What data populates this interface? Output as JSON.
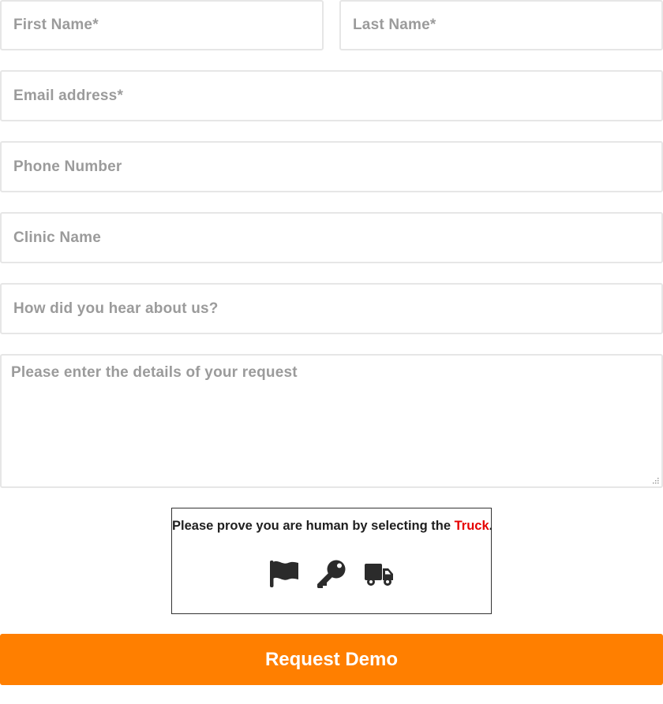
{
  "form": {
    "first_name_placeholder": "First Name*",
    "last_name_placeholder": "Last Name*",
    "email_placeholder": "Email address*",
    "phone_placeholder": "Phone Number",
    "clinic_placeholder": "Clinic Name",
    "hear_about_placeholder": "How did you hear about us?",
    "details_placeholder": "Please enter the details of your request"
  },
  "captcha": {
    "prompt_prefix": "Please prove you are human by selecting the ",
    "target_word": "Truck",
    "prompt_suffix": ".",
    "options": [
      "flag-icon",
      "key-icon",
      "truck-icon"
    ]
  },
  "submit": {
    "label": "Request Demo"
  },
  "colors": {
    "accent": "#ff7f00",
    "captcha_target": "#e60000",
    "placeholder_text": "#9b9b9b",
    "field_border": "#e6e6e6",
    "icon": "#2b2b2b"
  }
}
